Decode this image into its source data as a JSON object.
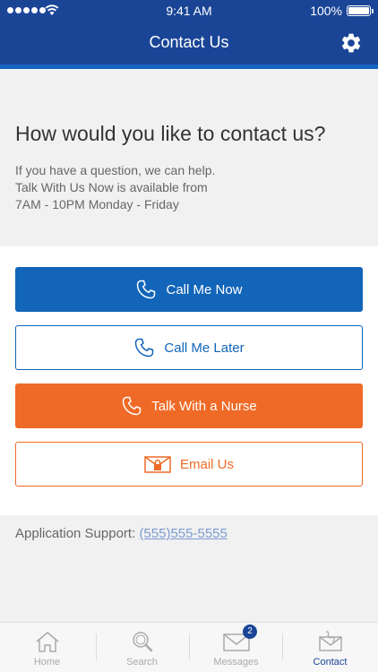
{
  "status_bar": {
    "time": "9:41 AM",
    "battery": "100%"
  },
  "header": {
    "title": "Contact Us",
    "settings_icon": "gear-icon"
  },
  "intro": {
    "heading": "How would you like to contact us?",
    "line1": "If you have a question, we can help.",
    "line2": "Talk With Us Now is available from",
    "line3": "7AM - 10PM Monday - Friday"
  },
  "actions": {
    "call_now": "Call Me Now",
    "call_later": "Call Me Later",
    "nurse": "Talk With a Nurse",
    "email": "Email Us"
  },
  "support": {
    "label": "Application Support:",
    "phone": "(555)555-5555"
  },
  "tabs": [
    {
      "label": "Home",
      "icon": "home-icon"
    },
    {
      "label": "Search",
      "icon": "search-icon"
    },
    {
      "label": "Messages",
      "icon": "envelope-icon",
      "badge": "2"
    },
    {
      "label": "Contact",
      "icon": "contact-icon",
      "active": true
    }
  ],
  "colors": {
    "brand_blue": "#1a4596",
    "button_blue": "#1265b8",
    "accent_orange": "#ef6a26"
  }
}
